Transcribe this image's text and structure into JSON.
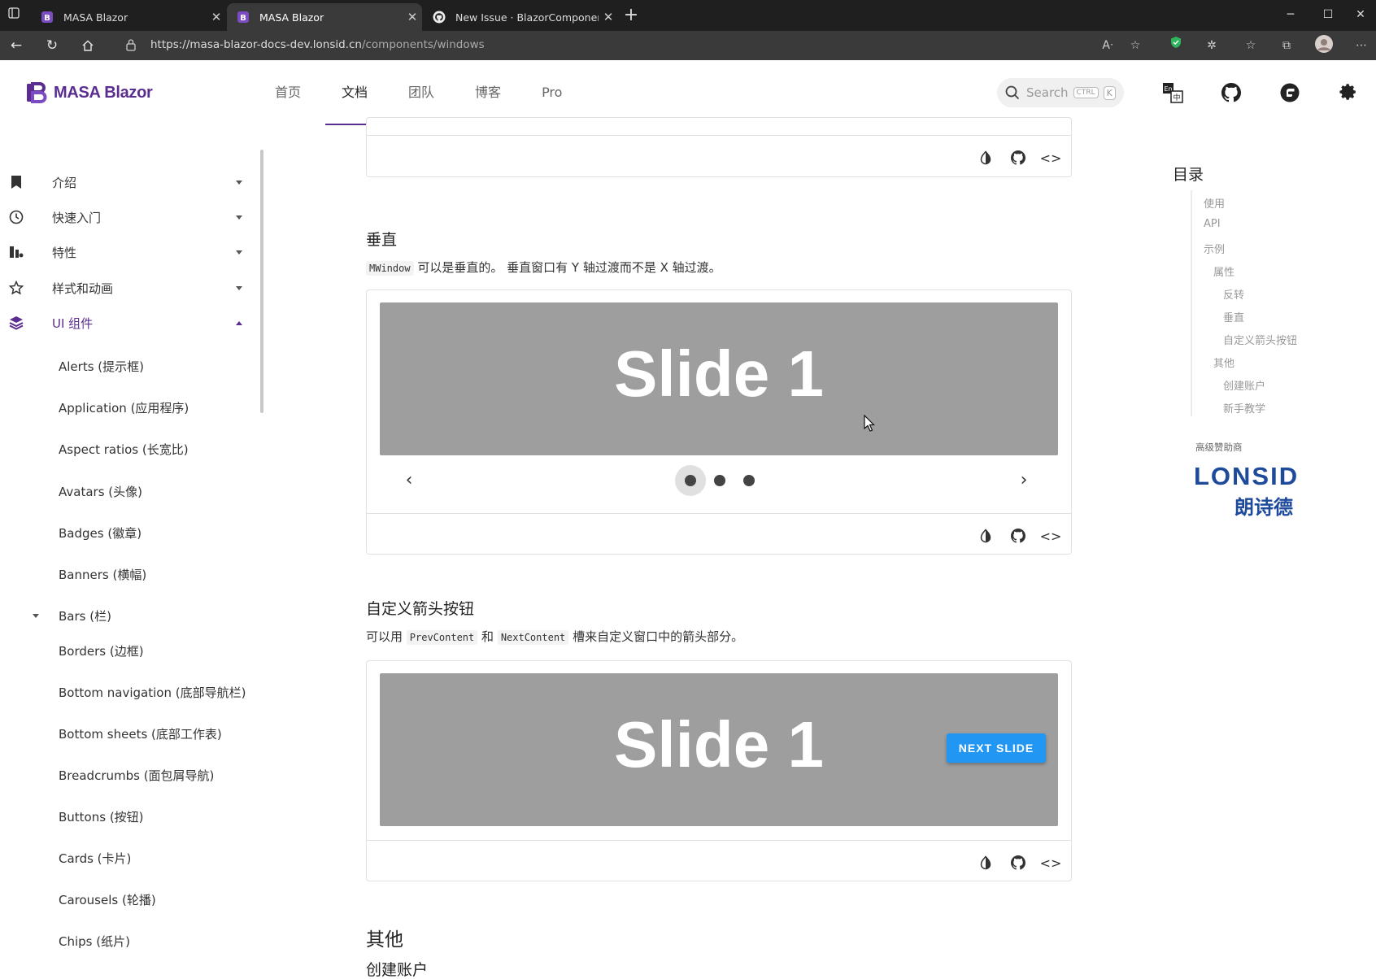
{
  "browser": {
    "tabs": [
      {
        "title": "MASA Blazor",
        "active": false
      },
      {
        "title": "MASA Blazor",
        "active": true
      },
      {
        "title": "New Issue · BlazorComponent/M",
        "active": false
      }
    ],
    "url_host": "https://masa-blazor-docs-dev.lonsid.cn",
    "url_path": "/components/windows"
  },
  "header": {
    "brand": "MASA Blazor",
    "nav": [
      "首页",
      "文档",
      "团队",
      "博客",
      "Pro"
    ],
    "active_nav": "文档",
    "search_placeholder": "Search",
    "search_kbd_ctrl": "CTRL",
    "search_kbd_key": "K"
  },
  "sidebar": {
    "sections": [
      {
        "label": "介绍",
        "icon": "bookmark-icon"
      },
      {
        "label": "快速入门",
        "icon": "clock-icon"
      },
      {
        "label": "特性",
        "icon": "features-icon"
      },
      {
        "label": "样式和动画",
        "icon": "star-icon"
      },
      {
        "label": "UI 组件",
        "icon": "layers-icon",
        "expanded": true
      }
    ],
    "components": [
      "Alerts (提示框)",
      "Application (应用程序)",
      "Aspect ratios (长宽比)",
      "Avatars (头像)",
      "Badges (徽章)",
      "Banners (横幅)"
    ],
    "group_label": "Bars (栏)",
    "components_after": [
      "Borders (边框)",
      "Bottom navigation (底部导航栏)",
      "Bottom sheets (底部工作表)",
      "Breadcrumbs (面包屑导航)",
      "Buttons (按钮)",
      "Cards (卡片)",
      "Carousels (轮播)",
      "Chips (纸片)"
    ]
  },
  "main": {
    "vertical": {
      "title": "垂直",
      "code": "MWindow",
      "desc_rest": " 可以是垂直的。 垂直窗口有 Y 轴过渡而不是 X 轴过渡。",
      "slide_text": "Slide 1",
      "dots": 3,
      "active_dot": 1
    },
    "custom_arrows": {
      "title": "自定义箭头按钮",
      "desc_a": "可以用 ",
      "code_a": "PrevContent",
      "desc_b": " 和 ",
      "code_b": "NextContent",
      "desc_c": " 槽来自定义窗口中的箭头部分。",
      "slide_text": "Slide 1",
      "next_label": "NEXT SLIDE"
    },
    "other_title": "其他",
    "create_account_title": "创建账户"
  },
  "toc": {
    "title": "目录",
    "items": [
      {
        "label": "使用",
        "level": 0
      },
      {
        "label": "API",
        "level": 0
      },
      {
        "label": "示例",
        "level": 0
      },
      {
        "label": "属性",
        "level": 1
      },
      {
        "label": "反转",
        "level": 2
      },
      {
        "label": "垂直",
        "level": 2
      },
      {
        "label": "自定义箭头按钮",
        "level": 2
      },
      {
        "label": "其他",
        "level": 1
      },
      {
        "label": "创建账户",
        "level": 2
      },
      {
        "label": "新手教学",
        "level": 2
      }
    ],
    "sponsor_label": "高级赞助商",
    "sponsor_name": "LONSID",
    "sponsor_name_cn": "朗诗德"
  },
  "colors": {
    "brand": "#5b2d91",
    "accent_button": "#2196f3",
    "slide_bg": "#9e9e9e"
  }
}
